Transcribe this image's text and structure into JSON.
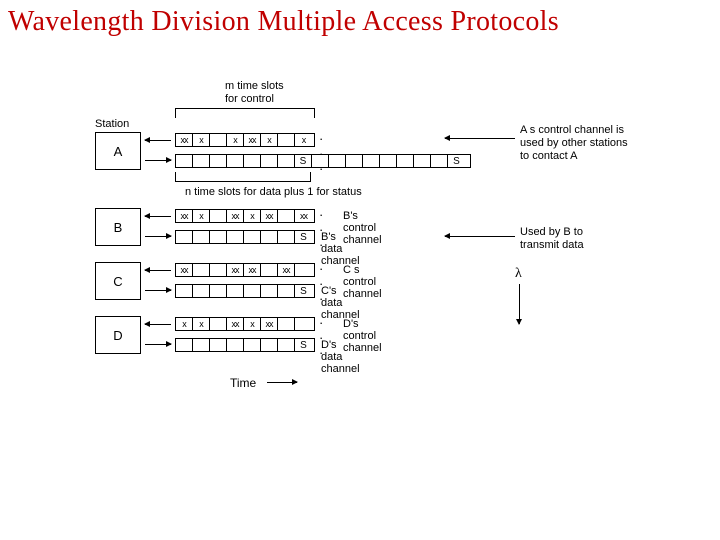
{
  "title": "Wavelength Division Multiple Access Protocols",
  "top_annotation": {
    "l1": "m time slots",
    "l2": "for control"
  },
  "station_header": "Station",
  "mid_annotation": "n time slots for data plus 1 for status",
  "stations": {
    "A": {
      "name": "A",
      "ctrl_slots": [
        "xx",
        "x",
        "",
        "x",
        "xx",
        "x",
        "",
        "x"
      ],
      "data_slots": [
        "",
        "",
        "",
        "",
        "",
        "",
        "",
        "S",
        "",
        "",
        "",
        "",
        "",
        "",
        "",
        "",
        "S"
      ],
      "right": {
        "l1": "A s control channel is",
        "l2": "used by other stations",
        "l3": "to contact A"
      }
    },
    "B": {
      "name": "B",
      "ctrl_slots": [
        "xx",
        "x",
        "",
        "xx",
        "x",
        "xx",
        "",
        "xx"
      ],
      "ctrl_label_suffix": "B's control channel",
      "data_slots": [
        "",
        "",
        "",
        "",
        "",
        "",
        "",
        "S"
      ],
      "data_label_suffix": "B's data channel",
      "right": {
        "l1": "Used by B to",
        "l2": "transmit data"
      }
    },
    "C": {
      "name": "C",
      "ctrl_slots": [
        "xx",
        "",
        "",
        "xx",
        "xx",
        "",
        "xx",
        ""
      ],
      "ctrl_label_suffix": "C s control channel",
      "data_slots": [
        "",
        "",
        "",
        "",
        "",
        "",
        "",
        "S"
      ],
      "data_label_suffix": "C's data channel"
    },
    "D": {
      "name": "D",
      "ctrl_slots": [
        "x",
        "x",
        "",
        "xx",
        "x",
        "xx",
        "",
        ""
      ],
      "ctrl_label_suffix": "D's control channel",
      "data_slots": [
        "",
        "",
        "",
        "",
        "",
        "",
        "",
        "S"
      ],
      "data_label_suffix": "D's data channel"
    }
  },
  "lambda_symbol": "λ",
  "time_label": "Time",
  "dots": "· · ·"
}
